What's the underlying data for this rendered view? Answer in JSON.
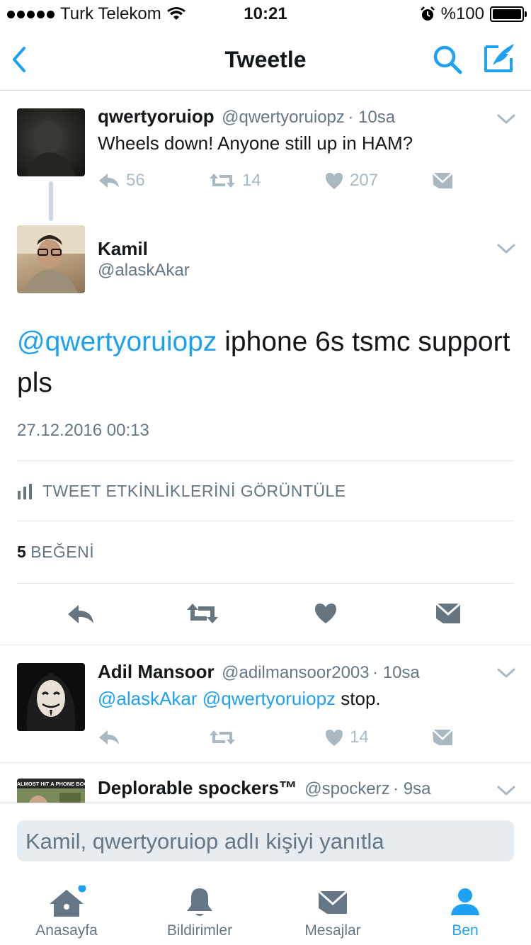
{
  "status_bar": {
    "carrier": "Turk Telekom",
    "time": "10:21",
    "battery": "%100",
    "battery_level": 1.0
  },
  "nav": {
    "title": "Tweetle",
    "back_icon": "chevron-left-icon",
    "search_icon": "search-icon",
    "compose_icon": "compose-icon"
  },
  "parent_tweet": {
    "name": "qwertyoruiop",
    "handle": "@qwertyoruiopz",
    "time": "· 10sa",
    "text": "Wheels down! Anyone still up in HAM?",
    "reply_count": "56",
    "retweet_count": "14",
    "like_count": "207"
  },
  "focus_tweet": {
    "name": "Kamil",
    "handle": "@alaskAkar",
    "mention": "@qwertyoruiopz",
    "text": " iphone 6s tsmc support pls",
    "timestamp": "27.12.2016 00:13",
    "activity_label": "TWEET ETKİNLİKLERİNİ GÖRÜNTÜLE",
    "likes_count": "5",
    "likes_label": "BEĞENİ"
  },
  "reply_tweet": {
    "name": "Adil Mansoor",
    "handle": "@adilmansoor2003",
    "time": "· 10sa",
    "mention1": "@alaskAkar",
    "mention2": "@qwertyoruiopz",
    "text": " stop.",
    "like_count": "14"
  },
  "partial_tweet": {
    "name": "Deplorable spockers™",
    "handle": "@spockerz",
    "time": "· 9sa",
    "avatar_caption": "WE ALMOST HIT A PHONE BOOTH"
  },
  "reply_box": {
    "placeholder": "Kamil, qwertyoruiop adlı kişiyi yanıtla"
  },
  "tabs": [
    {
      "label": "Anasayfa",
      "icon": "home-icon"
    },
    {
      "label": "Bildirimler",
      "icon": "bell-icon"
    },
    {
      "label": "Mesajlar",
      "icon": "envelope-icon"
    },
    {
      "label": "Ben",
      "icon": "person-icon"
    }
  ],
  "colors": {
    "accent": "#1da1f2",
    "muted": "#aab8c2",
    "gray_text": "#657786",
    "icon_dark": "#66757f"
  }
}
